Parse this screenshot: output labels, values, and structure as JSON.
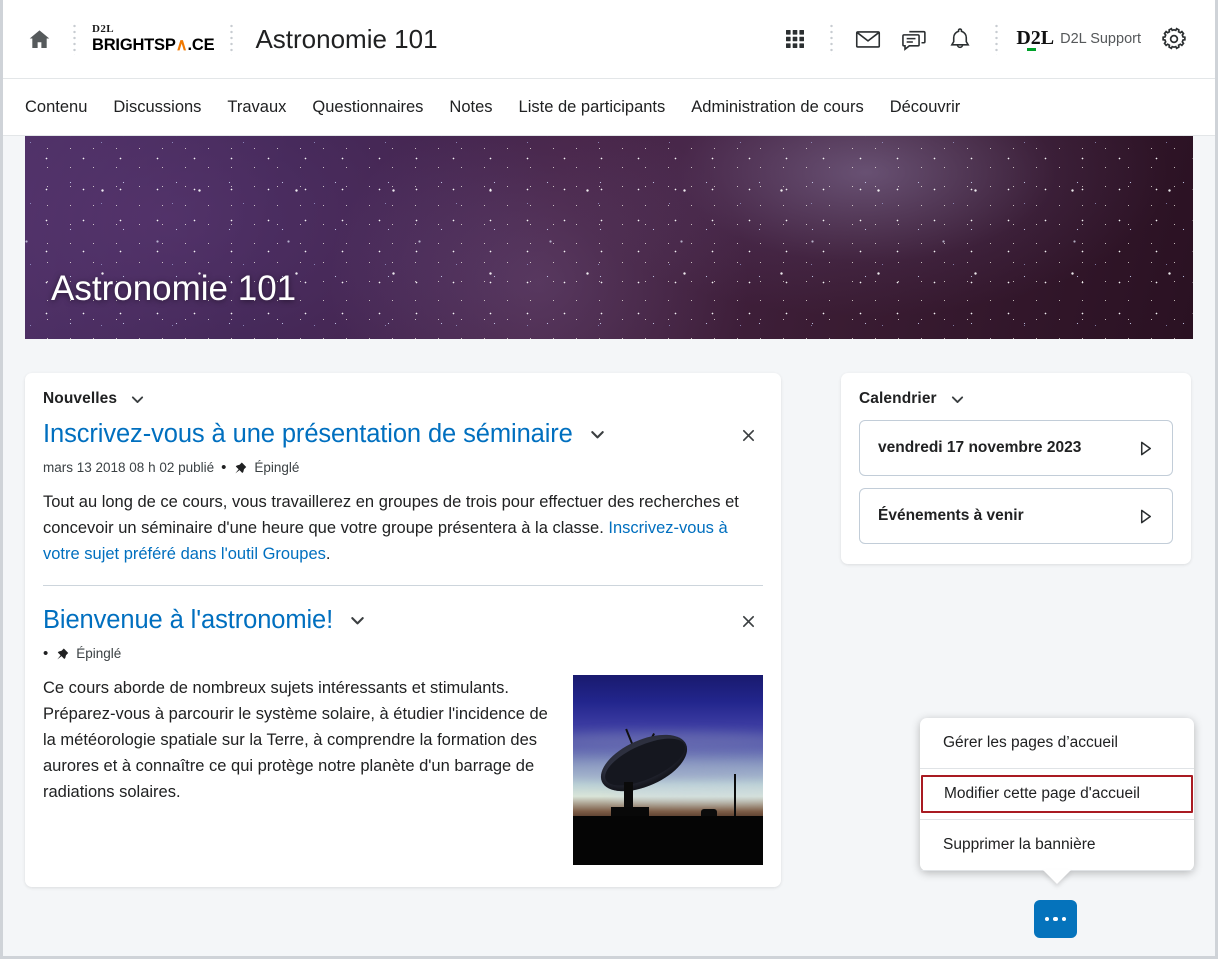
{
  "header": {
    "home_icon": "home-icon",
    "brand_top": "D2L",
    "brand_word_a": "BRIGHTSP",
    "brand_word_accent": "∧",
    "brand_word_b": ".CE",
    "course_title": "Astronomie 101",
    "icons": [
      "waffle-grid-icon",
      "envelope-icon",
      "chat-bubble-icon",
      "bell-icon"
    ],
    "d2l_mark": "D2L",
    "support_label": "D2L Support",
    "settings_icon": "gear-icon"
  },
  "nav": {
    "items": [
      {
        "label": "Contenu"
      },
      {
        "label": "Discussions"
      },
      {
        "label": "Travaux"
      },
      {
        "label": "Questionnaires"
      },
      {
        "label": "Notes"
      },
      {
        "label": "Liste de participants"
      },
      {
        "label": "Administration de cours"
      },
      {
        "label": "Découvrir"
      }
    ]
  },
  "banner": {
    "title": "Astronomie 101"
  },
  "news": {
    "widget_title": "Nouvelles",
    "items": [
      {
        "title": "Inscrivez-vous à une présentation de séminaire",
        "date": "mars 13 2018 08 h 02 publié",
        "pinned_label": "Épinglé",
        "body_before_link": "Tout au long de ce cours, vous travaillerez en groupes de trois pour effectuer des recherches et concevoir un séminaire d'une heure que votre groupe présentera à la classe. ",
        "link_text": "Inscrivez-vous à votre sujet préféré dans l'outil Groupes",
        "body_after_link": "."
      },
      {
        "title": "Bienvenue à l'astronomie!",
        "date": "",
        "pinned_label": "Épinglé",
        "body_before_link": "Ce cours aborde de nombreux sujets intéressants et stimulants. Préparez-vous à parcourir le système solaire, à étudier l'incidence de la météorologie spatiale sur la Terre, à comprendre la formation des aurores et à connaître ce qui protège notre planète d'un barrage de radiations solaires.",
        "link_text": "",
        "body_after_link": "",
        "image_alt": "radio-telescope-at-dusk"
      }
    ]
  },
  "calendar": {
    "widget_title": "Calendrier",
    "rows": [
      {
        "label": "vendredi 17 novembre 2023"
      },
      {
        "label": "Événements à venir"
      }
    ]
  },
  "context_menu": {
    "items": [
      {
        "label": "Gérer les pages d’accueil",
        "highlighted": false
      },
      {
        "label": "Modifier cette page d'accueil",
        "highlighted": true
      },
      {
        "label": "Supprimer la bannière",
        "highlighted": false
      }
    ],
    "trigger_icon": "ellipsis-icon"
  },
  "colors": {
    "link_blue": "#006fbf",
    "fab_blue": "#0573bc",
    "highlight_red": "#a91b22",
    "accent_orange": "#f07800",
    "d2l_green": "#00a12a"
  }
}
